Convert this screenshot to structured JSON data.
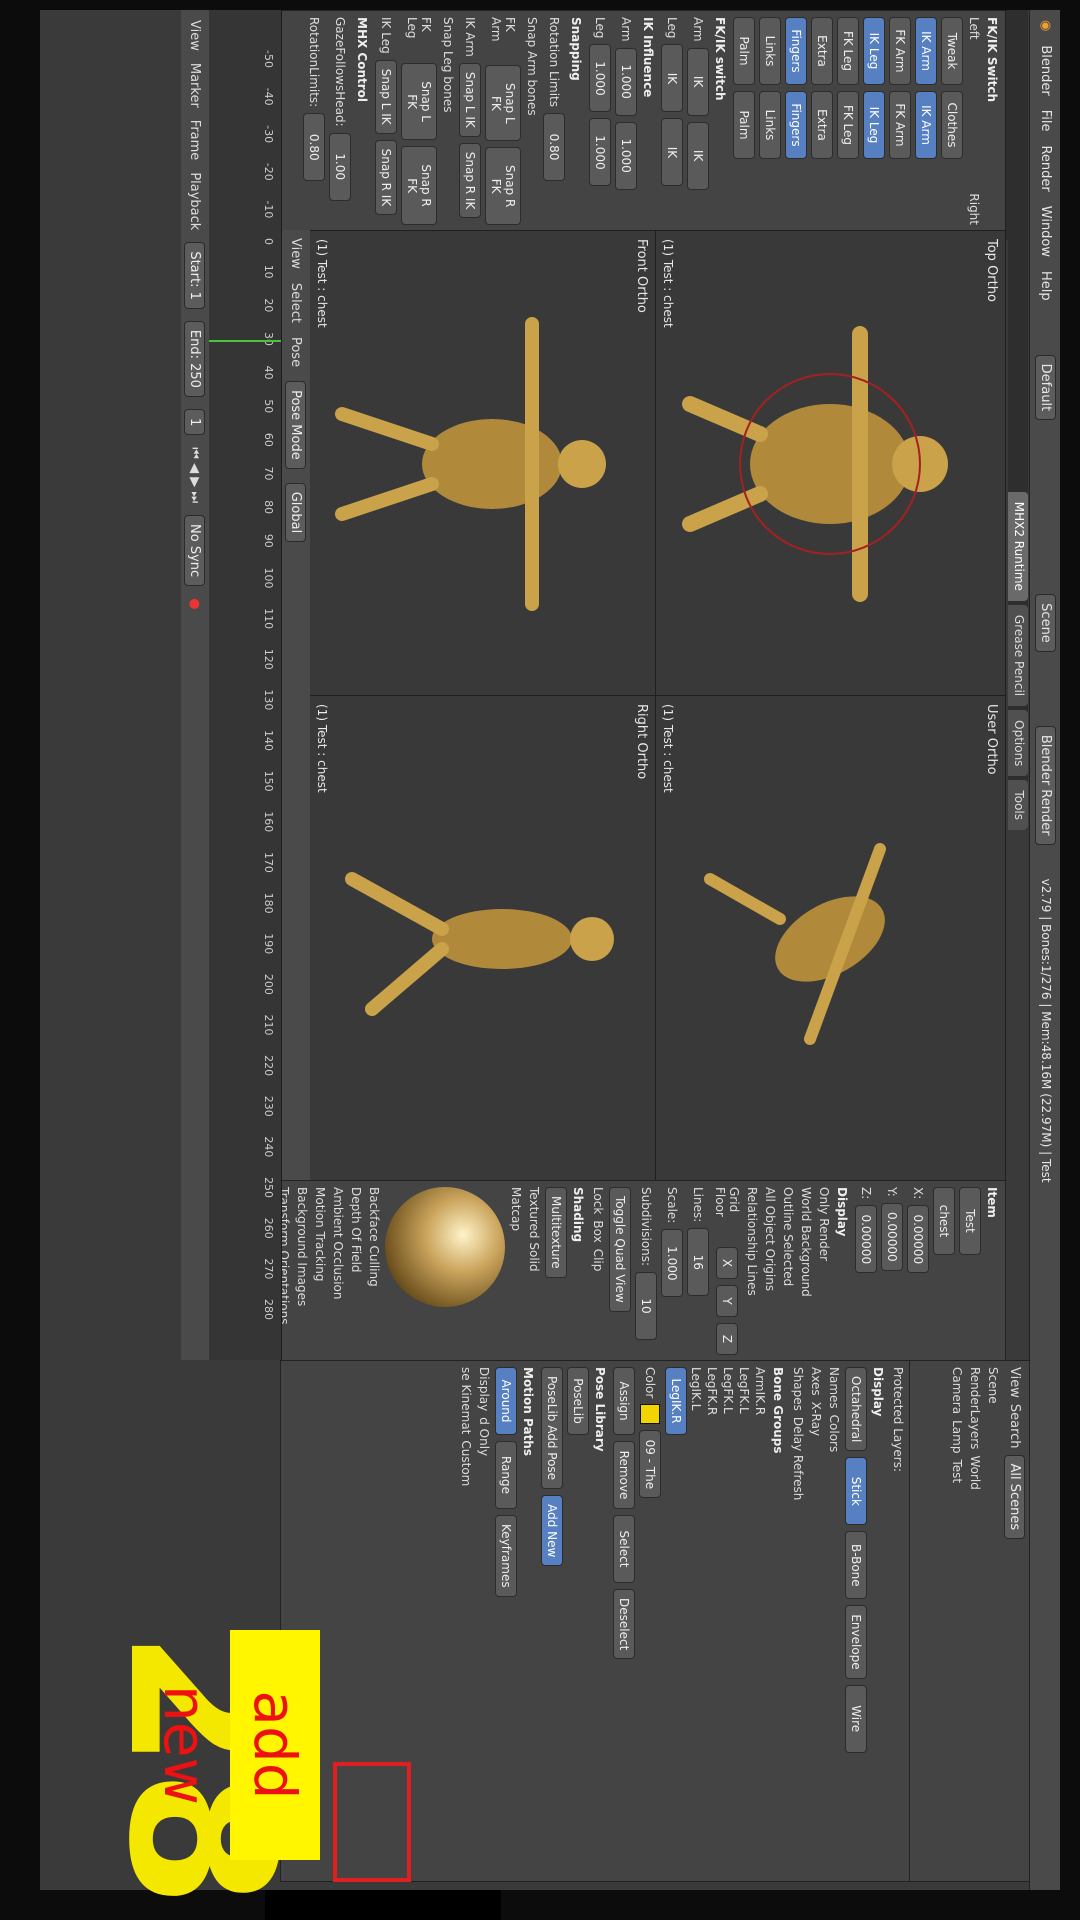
{
  "app": {
    "title": "Blender",
    "menu": [
      "File",
      "Render",
      "Window",
      "Help"
    ],
    "layout": "Default",
    "scene": "Scene",
    "engine": "Blender Render",
    "status": "v2.79 | Bones:1/276 | Mem:48.16M (22.97M) | Test"
  },
  "tool_tabs": [
    "MHX2 Runtime",
    "Grease Pencil",
    "Options",
    "Tools"
  ],
  "left_panel": {
    "fk_ik_header": "FK/IK Switch",
    "left_label": "Left",
    "right_label": "Right",
    "tweak_label": "Tweak",
    "clothes_label": "Clothes",
    "ik_arm": "IK Arm",
    "fk_arm": "FK Arm",
    "ik_leg": "IK Leg",
    "fk_leg": "FK Leg",
    "extra": "Extra",
    "fingers": "Fingers",
    "links": "Links",
    "palm": "Palm",
    "fkik_switch": "FK/IK switch",
    "arm": "Arm",
    "leg": "Leg",
    "ik_btn": "IK",
    "ik_influence": "IK Influence",
    "val_1000": "1.000",
    "snapping": "Snapping",
    "rotation_limits": "Rotation Limits",
    "rot_val": "0.80",
    "snap_arm_bones": "Snap Arm bones",
    "fk_arm_label": "FK Arm",
    "ik_arm_label": "IK Arm",
    "snap_leg_bones": "Snap Leg bones",
    "fk_leg_label": "FK Leg",
    "ik_leg_label": "IK Leg",
    "snap_l_fk": "Snap L FK",
    "snap_r_fk": "Snap R FK",
    "snap_l_ik": "Snap L IK",
    "snap_r_ik": "Snap R IK",
    "mhx_control": "MHX Control",
    "gaze_follows_head": "GazeFollowsHead:",
    "gaze_val": "1.00",
    "rotation_limits2": "RotationLimits:",
    "rot_val2": "0.80"
  },
  "viewports": [
    {
      "label": "Top Ortho",
      "sub": "(1) Test : chest"
    },
    {
      "label": "User Ortho",
      "sub": "(1) Test : chest"
    },
    {
      "label": "Front Ortho",
      "sub": "(1) Test : chest"
    },
    {
      "label": "Right Ortho",
      "sub": "(1) Test : chest"
    }
  ],
  "left_toolbar": {
    "view": "View",
    "select": "Select",
    "pose": "Pose",
    "mode": "Pose Mode",
    "orientation": "Global"
  },
  "properties": {
    "item_header": "Item",
    "bone_name": "Test",
    "bone": "chest",
    "x_label": "X:",
    "x_val": "0.00000",
    "y_label": "Y:",
    "y_val": "0.00000",
    "z_label": "Z:",
    "z_val": "0.00000",
    "display_header": "Display",
    "only_render": "Only Render",
    "world_background": "World Background",
    "outline_selected": "Outline Selected",
    "all_object_origins": "All Object Origins",
    "relationship_lines": "Relationship Lines",
    "grid_floor": "Grid Floor",
    "x": "X",
    "y": "Y",
    "z": "Z",
    "lines": "Lines:",
    "lines_val": "16",
    "scale": "Scale:",
    "scale_val": "1.000",
    "subdivisions": "Subdivisions:",
    "subdiv_val": "10",
    "toggle_quad": "Toggle Quad View",
    "lock": "Lock",
    "box": "Box",
    "clip": "Clip",
    "shading_header": "Shading",
    "multitexture": "Multitexture",
    "textured_solid": "Textured Solid",
    "matcap": "Matcap",
    "backface_culling": "Backface Culling",
    "depth_of_field": "Depth Of Field",
    "ambient_occlusion": "Ambient Occlusion",
    "motion_tracking": "Motion Tracking",
    "background_images": "Background Images",
    "transform_orientations": "Transform Orientations"
  },
  "outliner": {
    "view": "View",
    "search": "Search",
    "all_scenes": "All Scenes",
    "scene": "Scene",
    "render_layers": "RenderLayers",
    "world": "World",
    "camera": "Camera",
    "lamp": "Lamp",
    "test": "Test"
  },
  "armature": {
    "protected_layers": "Protected Layers:",
    "display_header": "Display",
    "octahedral": "Octahedral",
    "stick": "Stick",
    "bbone": "B-Bone",
    "envelope": "Envelope",
    "wire": "Wire",
    "names": "Names",
    "colors": "Colors",
    "axes": "Axes",
    "xray": "X-Ray",
    "shapes": "Shapes",
    "delay_refresh": "Delay Refresh",
    "bone_groups_header": "Bone Groups",
    "groups": [
      "ArmIK.R",
      "LegFK.L",
      "LegFK.L",
      "LegFK.R",
      "LegIK.L",
      "LegIK.R"
    ],
    "color": "Color",
    "color_set": "09 - The",
    "assign": "Assign",
    "remove": "Remove",
    "select": "Select",
    "deselect": "Deselect",
    "pose_library_header": "Pose Library",
    "poselib": "PoseLib",
    "add_pose": "PoseLib Add Pose",
    "add_new": "Add New",
    "motion_paths": "Motion Paths",
    "around": "Around",
    "range": "Range",
    "keyframes": "Keyframes",
    "display": "Display",
    "only": "d Only",
    "ik": "se Kinemat",
    "custom": "Custom"
  },
  "timeline": {
    "ticks": [
      "-50",
      "-40",
      "-30",
      "-20",
      "-10",
      "0",
      "10",
      "20",
      "30",
      "40",
      "50",
      "60",
      "70",
      "80",
      "90",
      "100",
      "110",
      "120",
      "130",
      "140",
      "150",
      "160",
      "170",
      "180",
      "190",
      "200",
      "210",
      "220",
      "230",
      "240",
      "250",
      "260",
      "270",
      "280"
    ],
    "view": "View",
    "marker": "Marker",
    "frame": "Frame",
    "playback": "Playback",
    "start": "Start:",
    "start_val": "1",
    "end": "End:",
    "end_val": "250",
    "current": "1",
    "sync": "No Sync"
  },
  "overlay": {
    "step_number": "28",
    "caption": "add new"
  }
}
